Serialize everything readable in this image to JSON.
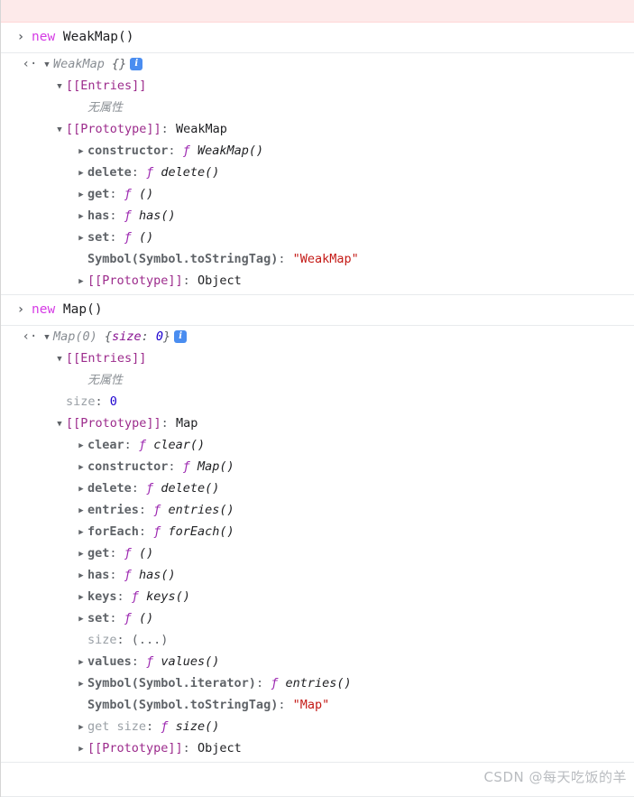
{
  "app": {
    "name": "chrome-devtools-console",
    "watermark": "CSDN @每天吃饭的羊"
  },
  "colors": {
    "keyword": "#d53be5",
    "internal_slot": "#9c2b8c",
    "string": "#c41a16",
    "number": "#1c00cf",
    "function_f": "#9c27b0",
    "property": "#5f6368",
    "object_name": "#888d93",
    "info_badge_bg": "#4a8df0",
    "error_row_bg": "#fdeaea",
    "separator": "#e8eaed"
  },
  "icons": {
    "prompt": "›",
    "return": "‹·",
    "twisty_open": "▼",
    "twisty_closed": "▶",
    "info": "i"
  },
  "error_strip": {
    "visible_fragment": "(   (   )      )",
    "note": "clipped error message row at top"
  },
  "entries": [
    {
      "type": "command",
      "keyword": "new",
      "expression": " WeakMap()"
    },
    {
      "type": "result",
      "object_name": "WeakMap",
      "preview": "{}",
      "info_badge": "i",
      "tree": [
        {
          "indent": 1,
          "twisty": "open",
          "label": "[[Entries]]",
          "kind": "internal"
        },
        {
          "indent": 2,
          "twisty": "none",
          "label": "无属性",
          "kind": "empty-note"
        },
        {
          "indent": 1,
          "twisty": "open",
          "label": "[[Prototype]]",
          "kind": "internal",
          "sep": ": ",
          "value": "WeakMap",
          "value_kind": "plain"
        },
        {
          "indent": 2,
          "twisty": "closed",
          "label": "constructor",
          "kind": "prop",
          "sep": ": ",
          "value": "WeakMap()",
          "value_kind": "fn"
        },
        {
          "indent": 2,
          "twisty": "closed",
          "label": "delete",
          "kind": "prop",
          "sep": ": ",
          "value": "delete()",
          "value_kind": "fn"
        },
        {
          "indent": 2,
          "twisty": "closed",
          "label": "get",
          "kind": "prop",
          "sep": ": ",
          "value": "()",
          "value_kind": "fn"
        },
        {
          "indent": 2,
          "twisty": "closed",
          "label": "has",
          "kind": "prop",
          "sep": ": ",
          "value": "has()",
          "value_kind": "fn"
        },
        {
          "indent": 2,
          "twisty": "closed",
          "label": "set",
          "kind": "prop",
          "sep": ": ",
          "value": "()",
          "value_kind": "fn"
        },
        {
          "indent": 2,
          "twisty": "none",
          "label": "Symbol(Symbol.toStringTag)",
          "kind": "symbol",
          "sep": ": ",
          "value": "\"WeakMap\"",
          "value_kind": "string"
        },
        {
          "indent": 2,
          "twisty": "closed",
          "label": "[[Prototype]]",
          "kind": "internal",
          "sep": ": ",
          "value": "Object",
          "value_kind": "plain"
        }
      ]
    },
    {
      "type": "command",
      "keyword": "new",
      "expression": " Map()"
    },
    {
      "type": "result",
      "object_name": "Map(0)",
      "preview_open": "{",
      "preview_key": "size",
      "preview_sep": ": ",
      "preview_value": "0",
      "preview_close": "}",
      "info_badge": "i",
      "tree": [
        {
          "indent": 1,
          "twisty": "open",
          "label": "[[Entries]]",
          "kind": "internal"
        },
        {
          "indent": 2,
          "twisty": "none",
          "label": "无属性",
          "kind": "empty-note"
        },
        {
          "indent": 1,
          "twisty": "none",
          "label": "size",
          "kind": "prop-plain",
          "sep": ": ",
          "value": "0",
          "value_kind": "number"
        },
        {
          "indent": 1,
          "twisty": "open",
          "label": "[[Prototype]]",
          "kind": "internal",
          "sep": ": ",
          "value": "Map",
          "value_kind": "plain"
        },
        {
          "indent": 2,
          "twisty": "closed",
          "label": "clear",
          "kind": "prop",
          "sep": ": ",
          "value": "clear()",
          "value_kind": "fn"
        },
        {
          "indent": 2,
          "twisty": "closed",
          "label": "constructor",
          "kind": "prop",
          "sep": ": ",
          "value": "Map()",
          "value_kind": "fn"
        },
        {
          "indent": 2,
          "twisty": "closed",
          "label": "delete",
          "kind": "prop",
          "sep": ": ",
          "value": "delete()",
          "value_kind": "fn"
        },
        {
          "indent": 2,
          "twisty": "closed",
          "label": "entries",
          "kind": "prop",
          "sep": ": ",
          "value": "entries()",
          "value_kind": "fn"
        },
        {
          "indent": 2,
          "twisty": "closed",
          "label": "forEach",
          "kind": "prop",
          "sep": ": ",
          "value": "forEach()",
          "value_kind": "fn"
        },
        {
          "indent": 2,
          "twisty": "closed",
          "label": "get",
          "kind": "prop",
          "sep": ": ",
          "value": "()",
          "value_kind": "fn"
        },
        {
          "indent": 2,
          "twisty": "closed",
          "label": "has",
          "kind": "prop",
          "sep": ": ",
          "value": "has()",
          "value_kind": "fn"
        },
        {
          "indent": 2,
          "twisty": "closed",
          "label": "keys",
          "kind": "prop",
          "sep": ": ",
          "value": "keys()",
          "value_kind": "fn"
        },
        {
          "indent": 2,
          "twisty": "closed",
          "label": "set",
          "kind": "prop",
          "sep": ": ",
          "value": "()",
          "value_kind": "fn"
        },
        {
          "indent": 2,
          "twisty": "none",
          "label": "size",
          "kind": "prop-plain",
          "sep": ": ",
          "value": "(...)",
          "value_kind": "dots"
        },
        {
          "indent": 2,
          "twisty": "closed",
          "label": "values",
          "kind": "prop",
          "sep": ": ",
          "value": "values()",
          "value_kind": "fn"
        },
        {
          "indent": 2,
          "twisty": "closed",
          "label": "Symbol(Symbol.iterator)",
          "kind": "symbol",
          "sep": ": ",
          "value": "entries()",
          "value_kind": "fn"
        },
        {
          "indent": 2,
          "twisty": "none",
          "label": "Symbol(Symbol.toStringTag)",
          "kind": "symbol",
          "sep": ": ",
          "value": "\"Map\"",
          "value_kind": "string"
        },
        {
          "indent": 2,
          "twisty": "closed",
          "label": "get size",
          "kind": "prop-getter",
          "sep": ": ",
          "value": "size()",
          "value_kind": "fn"
        },
        {
          "indent": 2,
          "twisty": "closed",
          "label": "[[Prototype]]",
          "kind": "internal",
          "sep": ": ",
          "value": "Object",
          "value_kind": "plain"
        }
      ]
    }
  ]
}
